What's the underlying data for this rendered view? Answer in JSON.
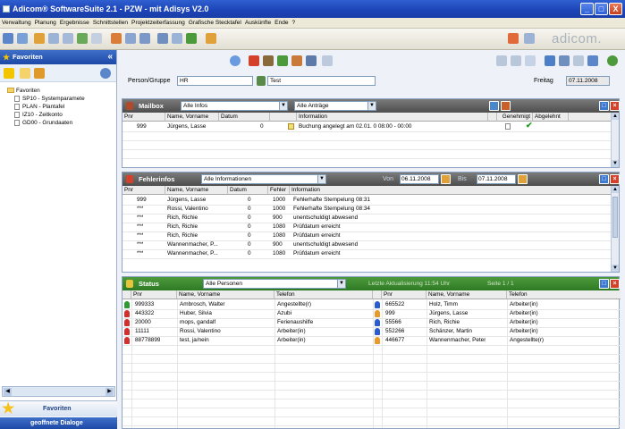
{
  "window": {
    "title": "Adicom® SoftwareSuite 2.1 - PZW - mit Adisys V2.0",
    "min": "_",
    "max": "□",
    "close": "X"
  },
  "menu": [
    "Verwaltung",
    "Planung",
    "Ergebnisse",
    "Schnittstellen",
    "Projektzeiterfassung",
    "Grafische Stecktafel",
    "Auskünfte",
    "Ende",
    "?"
  ],
  "brand": "adicom.",
  "sidebar": {
    "title": "Favoriten",
    "collapse": "«",
    "tree_root": "Favoriten",
    "items": [
      "SP10 - Systemparamete",
      "PLAN - Plantafel",
      "IZ10 - Zeitkonto",
      "GD00 - Grundaaten"
    ],
    "bottom_fav": "Favoriten",
    "bottom_dialogs": "geoffnete Dialoge"
  },
  "filter": {
    "person_label": "Person/Gruppe",
    "person_value": "HR",
    "person_name": "Test",
    "date_label": "Freitag",
    "date_value": "07.11.2008"
  },
  "mailbox": {
    "title": "Mailbox",
    "filter1": "Alle Infos",
    "filter2": "Alle Anträge",
    "columns": [
      "Pnr",
      "Name, Vorname",
      "Datum",
      "Information",
      "Genehmigt",
      "Abgelehnt"
    ],
    "rows": [
      {
        "pnr": "999",
        "name": "Jürgens, Lasse",
        "datum": "0",
        "info": "Buchung angelegt am 02.01.  0 08:00 - 00:00"
      }
    ]
  },
  "fehler": {
    "title": "Fehlerinfos",
    "filter": "Alle Informationen",
    "von_label": "Von",
    "von": "06.11.2008",
    "bis_label": "Bis",
    "bis": "07.11.2008",
    "columns": [
      "Pnr",
      "Name, Vorname",
      "Datum",
      "Fehler",
      "Information"
    ],
    "rows": [
      {
        "pnr": "999",
        "name": "Jürgens, Lasse",
        "datum": "0",
        "fehler": "1000",
        "info": "Fehlerhafte Stempelung 08:31"
      },
      {
        "pnr": "***",
        "name": "Rossi, Valentino",
        "datum": "0",
        "fehler": "1000",
        "info": "Fehlerhafte Stempelung 08:34"
      },
      {
        "pnr": "***",
        "name": "Rich, Richie",
        "datum": "0",
        "fehler": "900",
        "info": "unentschuldigt abwesend"
      },
      {
        "pnr": "***",
        "name": "Rich, Richie",
        "datum": "0",
        "fehler": "1080",
        "info": "Prüfdatum erreicht"
      },
      {
        "pnr": "***",
        "name": "Rich, Richie",
        "datum": "0",
        "fehler": "1080",
        "info": "Prüfdatum erreicht"
      },
      {
        "pnr": "***",
        "name": "Wannenmacher, P...",
        "datum": "0",
        "fehler": "900",
        "info": "unentschuldigt abwesend"
      },
      {
        "pnr": "***",
        "name": "Wannenmacher, P...",
        "datum": "0",
        "fehler": "1080",
        "info": "Prüfdatum erreicht"
      }
    ]
  },
  "status": {
    "title": "Status",
    "filter": "Alle Personen",
    "updated": "Letzte Aktualisierung 11:54 Uhr",
    "page": "Seite 1 / 1",
    "columns": [
      "Pnr",
      "Name, Vorname",
      "Telefon",
      "Pnr",
      "Name, Vorname",
      "Telefon"
    ],
    "left": [
      {
        "pnr": "999333",
        "name": "Ambrosch, Walter",
        "tel": "Angestellte(r)",
        "color": "#2f9a2f"
      },
      {
        "pnr": "443322",
        "name": "Huber, Silvia",
        "tel": "Azubi",
        "color": "#d32f2f"
      },
      {
        "pnr": "20000",
        "name": "mops, gandalf",
        "tel": "Ferienaushilfe",
        "color": "#d32f2f"
      },
      {
        "pnr": "11111",
        "name": "Rossi, Valentino",
        "tel": "Arbeiter(in)",
        "color": "#d32f2f"
      },
      {
        "pnr": "88778899",
        "name": "test, ja/nein",
        "tel": "Arbeiter(in)",
        "color": "#d32f2f"
      }
    ],
    "right": [
      {
        "pnr": "665522",
        "name": "Holz, Timm",
        "tel": "Arbeiter(in)",
        "color": "#2a5bd0"
      },
      {
        "pnr": "999",
        "name": "Jürgens, Lasse",
        "tel": "Arbeiter(in)",
        "color": "#e89a2a"
      },
      {
        "pnr": "55566",
        "name": "Rich, Richie",
        "tel": "Arbeiter(in)",
        "color": "#2a5bd0"
      },
      {
        "pnr": "552266",
        "name": "Schänzer, Martin",
        "tel": "Arbeiter(in)",
        "color": "#2a5bd0"
      },
      {
        "pnr": "446677",
        "name": "Wannenmacher, Peter",
        "tel": "Angestellte(r)",
        "color": "#e89a2a"
      }
    ]
  }
}
